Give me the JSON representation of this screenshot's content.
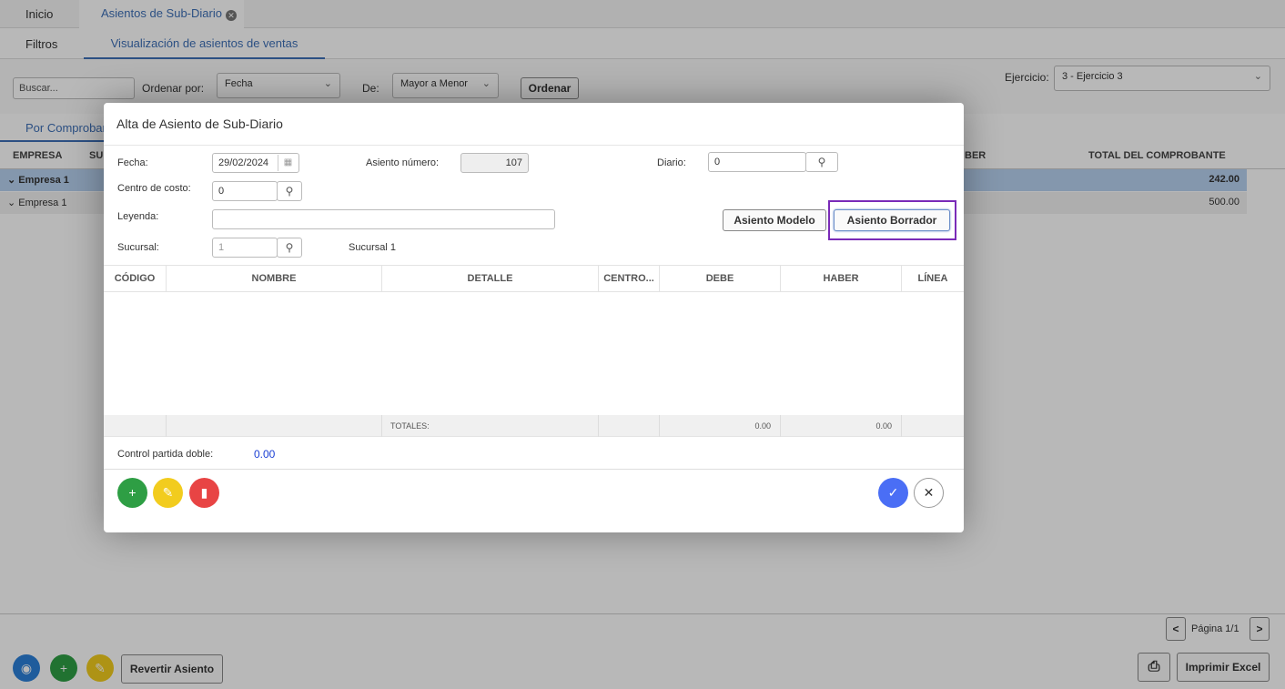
{
  "tabs": [
    {
      "label": "Inicio"
    },
    {
      "label": "Asientos de Sub-Diario"
    }
  ],
  "subtabs": [
    {
      "label": "Filtros"
    },
    {
      "label": "Visualización de asientos de ventas"
    }
  ],
  "filters": {
    "search_placeholder": "Buscar...",
    "order_by_label": "Ordenar por:",
    "order_by_value": "Fecha",
    "from_label": "De:",
    "from_value": "Mayor a Menor",
    "order_button": "Ordenar",
    "ejercicio_label": "Ejercicio:",
    "ejercicio_value": "3 - Ejercicio 3"
  },
  "view_tab": "Por Comprobar",
  "bg_table": {
    "headers": [
      "EMPRESA",
      "SU",
      "BER",
      "TOTAL DEL COMPROBANTE"
    ],
    "rows": [
      {
        "empresa": "Empresa 1",
        "total": "242.00"
      },
      {
        "empresa": "Empresa 1",
        "total": "500.00"
      }
    ]
  },
  "bg_footer": {
    "pagination": "Página 1/1",
    "prev": "<",
    "next": ">",
    "revert_button": "Revertir Asiento",
    "excel_button": "Imprimir Excel"
  },
  "modal": {
    "title": "Alta de Asiento de Sub-Diario",
    "fecha_label": "Fecha:",
    "fecha_value": "29/02/2024",
    "asiento_num_label": "Asiento número:",
    "asiento_num_value": "107",
    "diario_label": "Diario:",
    "diario_value": "0",
    "centro_label": "Centro de costo:",
    "centro_value": "0",
    "leyenda_label": "Leyenda:",
    "leyenda_value": "",
    "sucursal_label": "Sucursal:",
    "sucursal_value": "1",
    "sucursal_name": "Sucursal 1",
    "modelo_button": "Asiento Modelo",
    "borrador_button": "Asiento Borrador",
    "grid_headers": [
      "CÓDIGO",
      "NOMBRE",
      "DETALLE",
      "CENTRO...",
      "DEBE",
      "HABER",
      "LÍNEA"
    ],
    "totals_label": "TOTALES:",
    "total_debe": "0.00",
    "total_haber": "0.00",
    "control_label": "Control partida doble:",
    "control_value": "0.00"
  },
  "colors": {
    "accent": "#3d6fb6",
    "green": "#2e9e44",
    "yellow": "#f2cc1e",
    "red": "#e84444",
    "confirm_blue": "#4a6ef5",
    "highlight": "#7a2bb8"
  }
}
